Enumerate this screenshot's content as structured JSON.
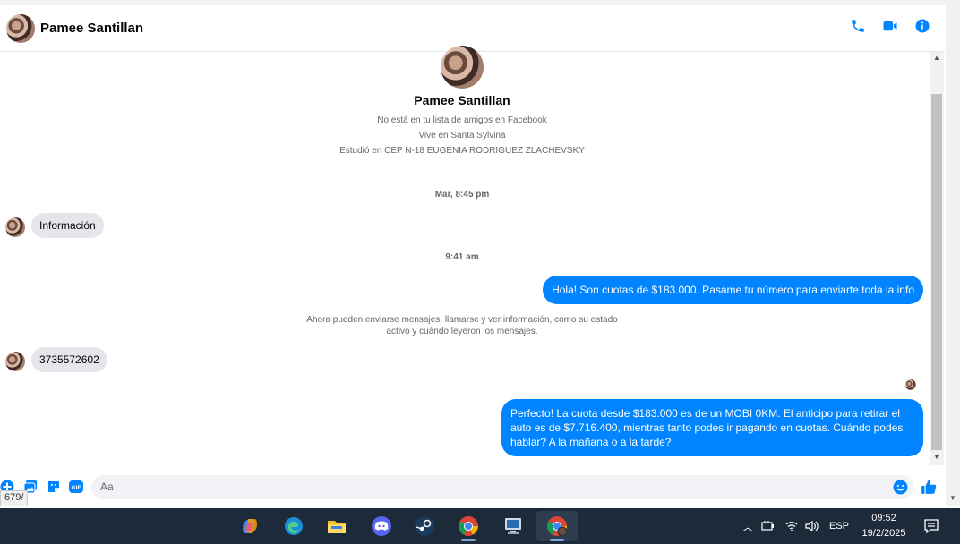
{
  "header": {
    "name": "Pamee Santillan",
    "actions": [
      "phone-icon",
      "video-icon",
      "info-icon"
    ],
    "accent": "#0084ff"
  },
  "intro": {
    "name": "Pamee Santillan",
    "lines": [
      "No está en tu lista de amigos en Facebook",
      "Vive en Santa Sylvina",
      "Estudió en CEP N-18 EUGENIA RODRIGUEZ ZLACHEVSKY"
    ]
  },
  "thread": {
    "ts1": "Mar, 8:45 pm",
    "msg1": "Información",
    "ts2": "9:41 am",
    "msg2": "Hola! Son cuotas de $183.000. Pasame tu número para enviarte toda la info",
    "notice_line1": "Ahora pueden enviarse mensajes, llamarse y ver información, como su estado",
    "notice_line2": "activo y cuándo leyeron los mensajes.",
    "msg3": "3735572602",
    "msg4": "Perfecto! La cuota desde $183.000 es de un MOBI 0KM. El anticipo para retirar el auto es de $7.716.400, mientras tanto podes ir pagando en cuotas. Cuándo podes hablar? A la mañana o a la tarde?"
  },
  "composer": {
    "placeholder": "Aa",
    "icons": [
      "plus-icon",
      "image-icon",
      "sticker-icon",
      "gif-icon",
      "emoji-icon",
      "like-icon"
    ],
    "gif_label": "GIF"
  },
  "status_url": "679/",
  "taskbar": {
    "apps": [
      "copilot-icon",
      "edge-icon",
      "file-explorer-icon",
      "discord-icon",
      "steam-icon",
      "chrome-icon",
      "network-app-icon",
      "chrome-profile-icon"
    ],
    "language": "ESP",
    "time": "09:52",
    "date": "19/2/2025"
  }
}
